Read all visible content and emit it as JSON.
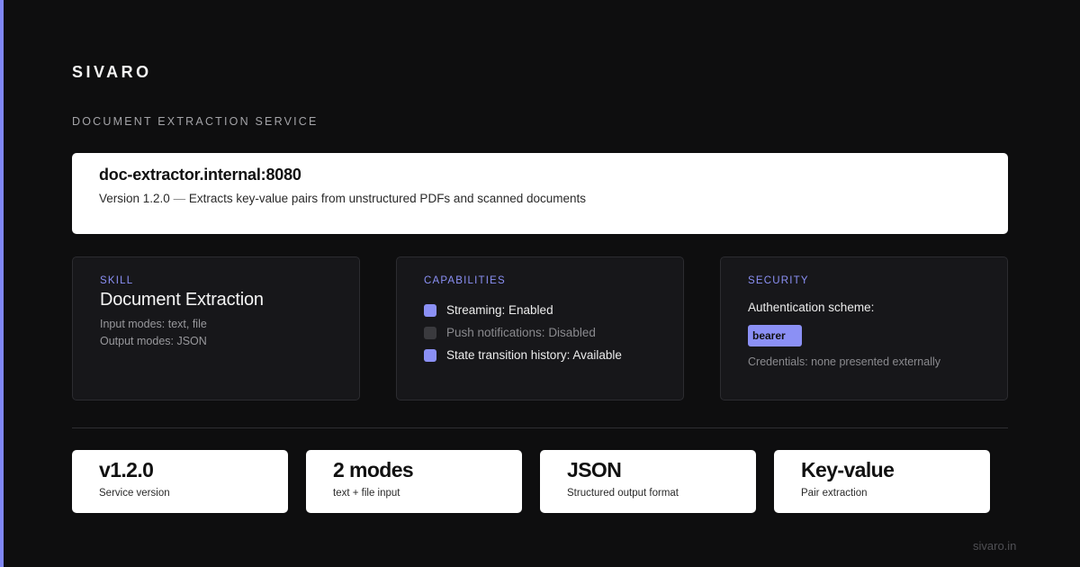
{
  "brand": "SIVARO",
  "subtitle": "DOCUMENT EXTRACTION SERVICE",
  "endpoint": {
    "host": "doc-extractor.internal:8080",
    "version": "Version 1.2.0",
    "separator": "—",
    "description": "Extracts key-value pairs from unstructured PDFs and scanned documents"
  },
  "skill": {
    "label": "SKILL",
    "name": "Document Extraction",
    "input_modes": "Input modes: text, file",
    "output_modes": "Output modes: JSON"
  },
  "capabilities": {
    "label": "CAPABILITIES",
    "items": [
      {
        "text": "Streaming: Enabled",
        "enabled": true
      },
      {
        "text": "Push notifications: Disabled",
        "enabled": false
      },
      {
        "text": "State transition history: Available",
        "enabled": true
      }
    ]
  },
  "security": {
    "label": "SECURITY",
    "auth_label": "Authentication scheme:",
    "scheme": "bearer",
    "credentials": "Credentials: none presented externally"
  },
  "stats": [
    {
      "value": "v1.2.0",
      "label": "Service version"
    },
    {
      "value": "2 modes",
      "label": "text + file input"
    },
    {
      "value": "JSON",
      "label": "Structured output format"
    },
    {
      "value": "Key-value",
      "label": "Pair extraction"
    }
  ],
  "footer": "sivaro.in",
  "colors": {
    "accent": "#7f86f5",
    "background": "#0e0e0f",
    "panel": "#17171a"
  }
}
